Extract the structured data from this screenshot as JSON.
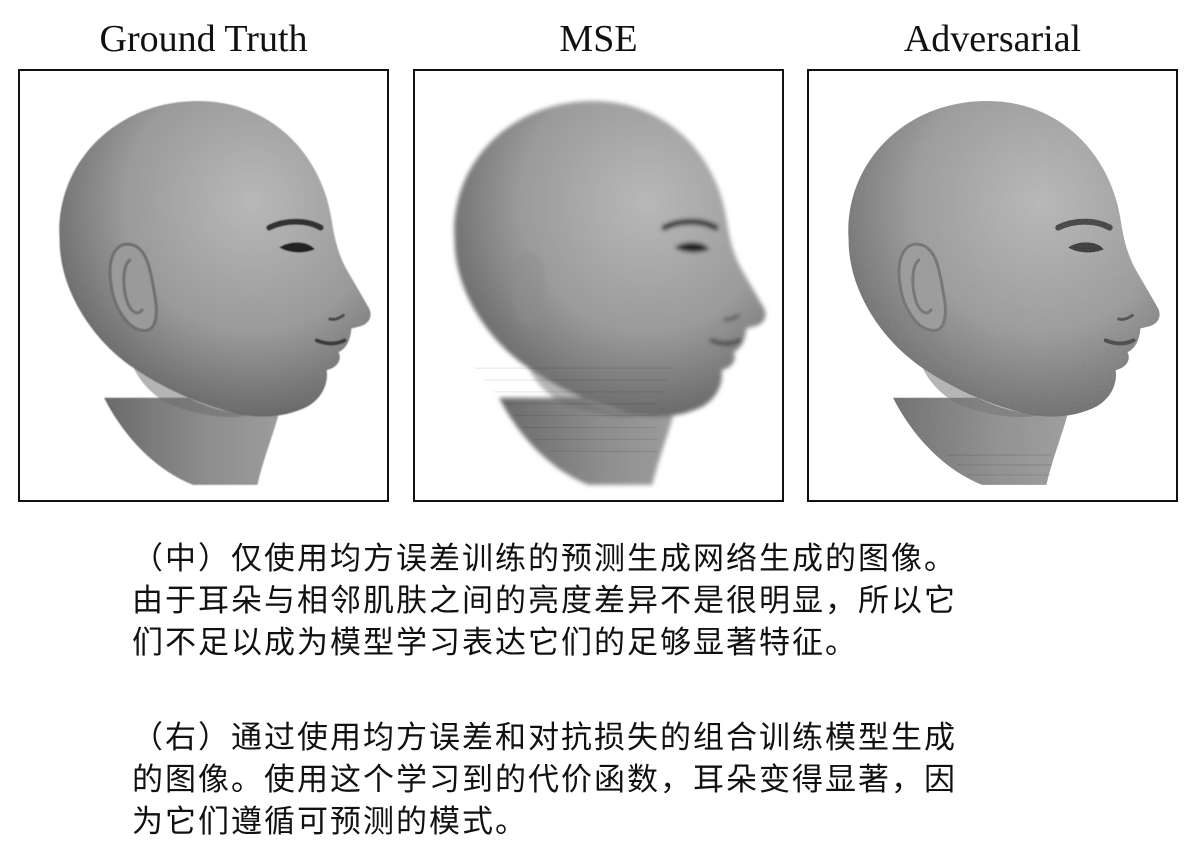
{
  "panels": [
    {
      "title": "Ground Truth",
      "image_description": "bald-head-profile-sharp"
    },
    {
      "title": "MSE",
      "image_description": "bald-head-profile-blurred-missing-ear"
    },
    {
      "title": "Adversarial",
      "image_description": "bald-head-profile-textured-with-ear"
    }
  ],
  "captions": [
    {
      "lines": [
        "（中）仅使用均方误差训练的预测生成网络生成的图像。",
        "由于耳朵与相邻肌肤之间的亮度差异不是很明显，所以它",
        "们不足以成为模型学习表达它们的足够显著特征。"
      ]
    },
    {
      "lines": [
        "（右）通过使用均方误差和对抗损失的组合训练模型生成",
        "的图像。使用这个学习到的代价函数，耳朵变得显著，因",
        "为它们遵循可预测的模式。"
      ]
    }
  ],
  "colors": {
    "border": "#111111",
    "skin_light": "#b4b4b4",
    "skin_dark": "#5e5e5e"
  }
}
